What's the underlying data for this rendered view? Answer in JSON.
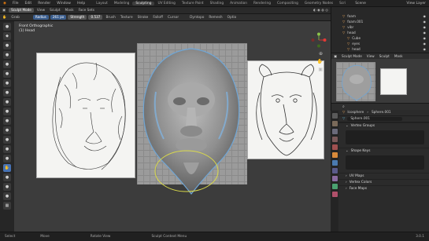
{
  "menus": [
    "File",
    "Edit",
    "Render",
    "Window",
    "Help"
  ],
  "workspace_tabs": [
    {
      "label": "Layout",
      "active": false
    },
    {
      "label": "Modeling",
      "active": false
    },
    {
      "label": "Sculpting",
      "active": true
    },
    {
      "label": "UV Editing",
      "active": false
    },
    {
      "label": "Texture Paint",
      "active": false
    },
    {
      "label": "Shading",
      "active": false
    },
    {
      "label": "Animation",
      "active": false
    },
    {
      "label": "Rendering",
      "active": false
    },
    {
      "label": "Compositing",
      "active": false
    },
    {
      "label": "Geometry Nodes",
      "active": false
    },
    {
      "label": "Scri",
      "active": false
    }
  ],
  "scene": {
    "label": "Scene",
    "view_layer": "View Layer"
  },
  "mode_header": {
    "mode": "Sculpt Mode",
    "items": [
      "View",
      "Sculpt",
      "Mask",
      "Face Sets"
    ]
  },
  "tool_header": {
    "brush_name": "Grab",
    "radius_label": "Radius",
    "radius_value": "261 px",
    "strength_label": "Strength",
    "strength_value": "0.537",
    "menus": [
      "Brush",
      "Texture",
      "Stroke",
      "Falloff",
      "Cursor"
    ],
    "right": [
      "Dyntopo",
      "Remesh",
      "Optio"
    ]
  },
  "viewport": {
    "view_name": "Front Orthographic",
    "collection_info": "(1) Head"
  },
  "outliner": {
    "rows": [
      {
        "label": "foam"
      },
      {
        "label": "foam.001"
      },
      {
        "label": "vibr"
      },
      {
        "label": "head"
      },
      {
        "label": "Cube"
      },
      {
        "label": "eyes"
      },
      {
        "label": "head"
      }
    ]
  },
  "image_editor": {
    "menus": [
      "Sculpt Mode",
      "View",
      "Sculpt",
      "Mask"
    ]
  },
  "properties": {
    "object_name": "Icosphere",
    "mesh_name": "Sphere.001",
    "data_name": "Sphere.001",
    "sections": [
      "Vertex Groups",
      "Shape Keys",
      "UV Maps",
      "Vertex Colors",
      "Face Maps"
    ]
  },
  "status": {
    "left": "Select",
    "middle_left": "Move",
    "middle": "Rotate View",
    "right": "Sculpt Context Menu",
    "version": "3.0.1"
  },
  "colors": {
    "accent": "#4772b3",
    "active_tab": "#3d3d3d",
    "field_blue": "#3b5e8e",
    "brush_circle": "#d9d94a"
  }
}
